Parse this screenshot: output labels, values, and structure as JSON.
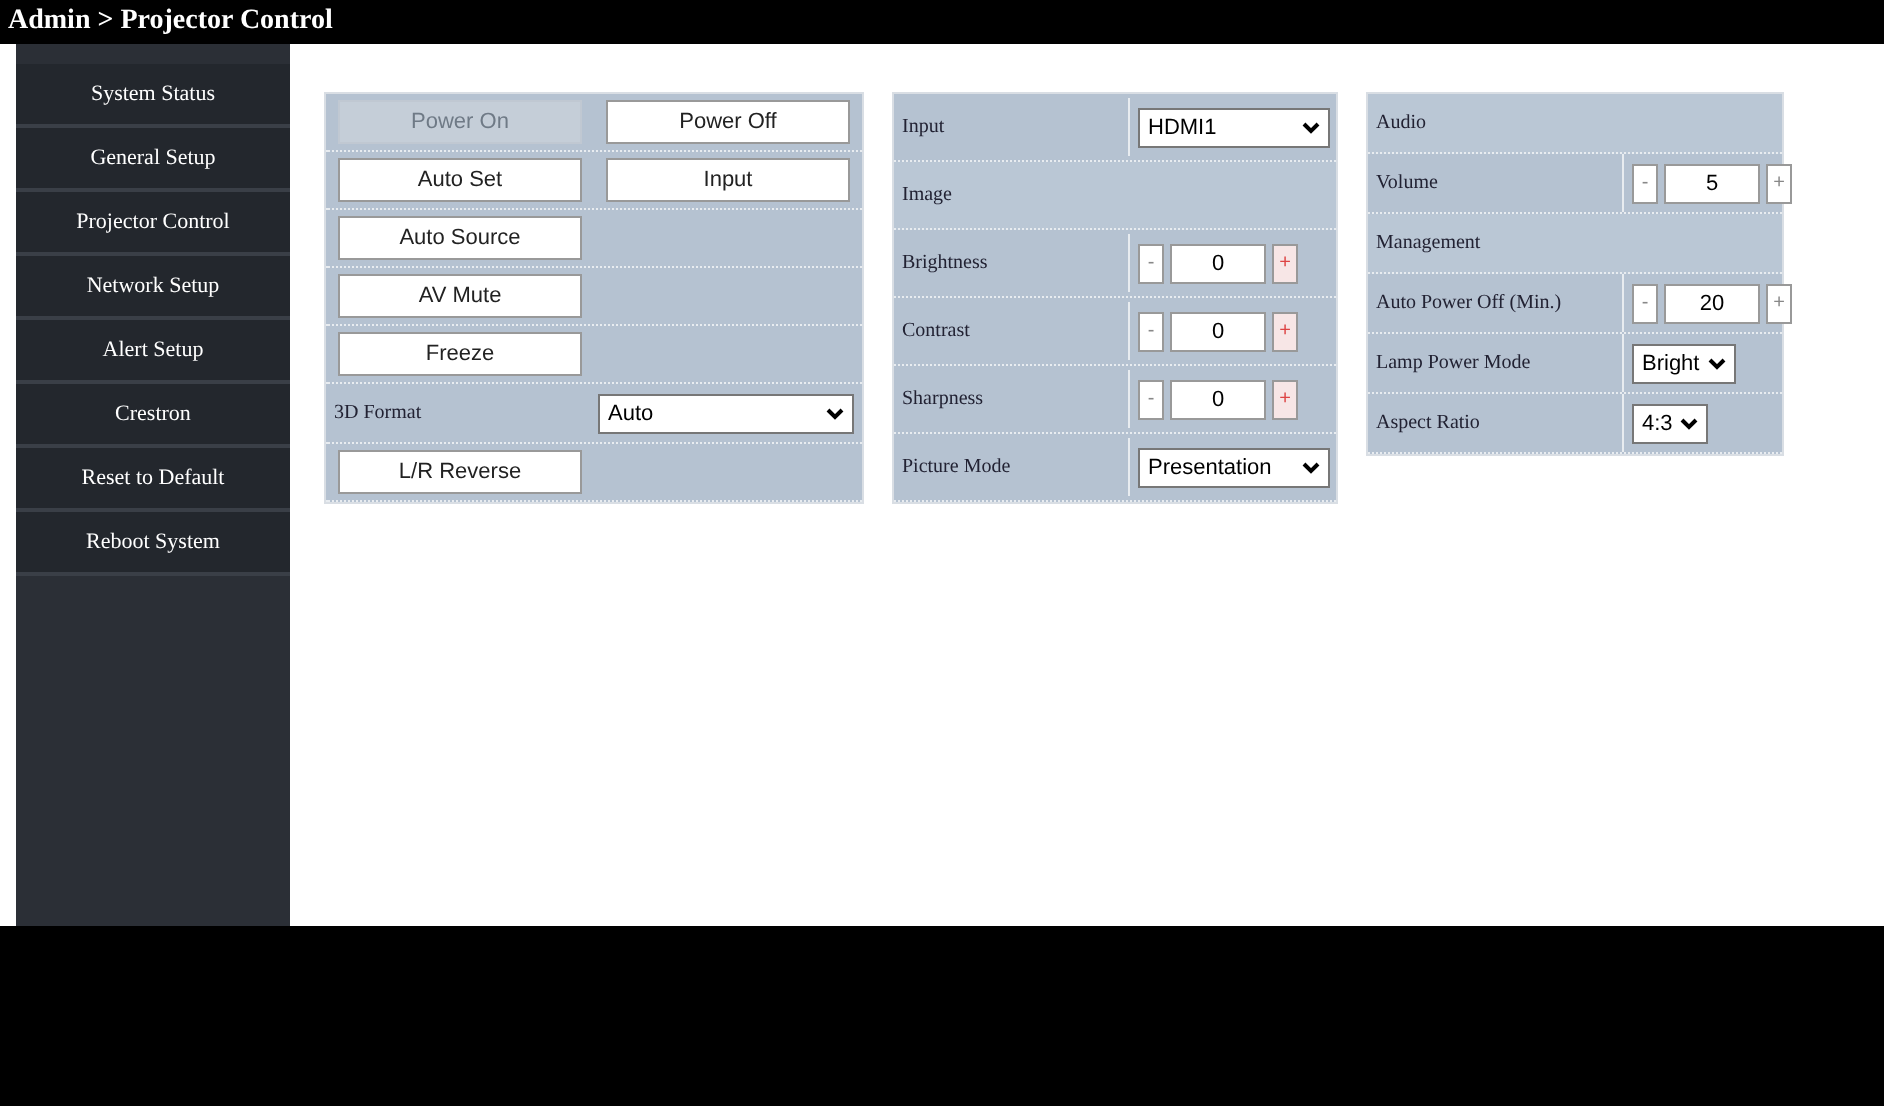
{
  "title": "Admin > Projector Control",
  "sidebar": {
    "items": [
      {
        "label": "System Status"
      },
      {
        "label": "General Setup"
      },
      {
        "label": "Projector Control"
      },
      {
        "label": "Network Setup"
      },
      {
        "label": "Alert Setup"
      },
      {
        "label": "Crestron"
      },
      {
        "label": "Reset to Default"
      },
      {
        "label": "Reboot System"
      }
    ]
  },
  "control_panel": {
    "rows": [
      {
        "kind": "buttons",
        "buttons": [
          {
            "label": "Power On",
            "disabled": true
          },
          {
            "label": "Power Off",
            "disabled": false
          }
        ]
      },
      {
        "kind": "buttons",
        "buttons": [
          {
            "label": "Auto Set",
            "disabled": false
          },
          {
            "label": "Input",
            "disabled": false
          }
        ]
      },
      {
        "kind": "buttons",
        "buttons": [
          {
            "label": "Auto Source",
            "disabled": false
          }
        ]
      },
      {
        "kind": "buttons",
        "buttons": [
          {
            "label": "AV Mute",
            "disabled": false
          }
        ]
      },
      {
        "kind": "buttons",
        "buttons": [
          {
            "label": "Freeze",
            "disabled": false
          }
        ]
      },
      {
        "kind": "select",
        "label": "3D Format",
        "value": "Auto"
      },
      {
        "kind": "buttons",
        "buttons": [
          {
            "label": "L/R Reverse",
            "disabled": false
          }
        ]
      }
    ]
  },
  "image_panel": {
    "rows": [
      {
        "kind": "select",
        "label": "Input",
        "value": "HDMI1"
      },
      {
        "kind": "header",
        "label": "Image"
      },
      {
        "kind": "stepper",
        "label": "Brightness",
        "minus": "-",
        "value": "0",
        "plus": "+"
      },
      {
        "kind": "stepper",
        "label": "Contrast",
        "minus": "-",
        "value": "0",
        "plus": "+"
      },
      {
        "kind": "stepper",
        "label": "Sharpness",
        "minus": "-",
        "value": "0",
        "plus": "+"
      },
      {
        "kind": "select",
        "label": "Picture Mode",
        "value": "Presentation"
      }
    ]
  },
  "settings_panel": {
    "rows": [
      {
        "kind": "header",
        "label": "Audio"
      },
      {
        "kind": "stepper",
        "label": "Volume",
        "minus": "-",
        "value": "5",
        "plus": "+"
      },
      {
        "kind": "header",
        "label": "Management"
      },
      {
        "kind": "stepper",
        "label": "Auto Power Off (Min.)",
        "minus": "-",
        "value": "20",
        "plus": "+"
      },
      {
        "kind": "select",
        "label": "Lamp Power Mode",
        "value": "Bright"
      },
      {
        "kind": "select",
        "label": "Aspect Ratio",
        "value": "4:3"
      }
    ]
  }
}
